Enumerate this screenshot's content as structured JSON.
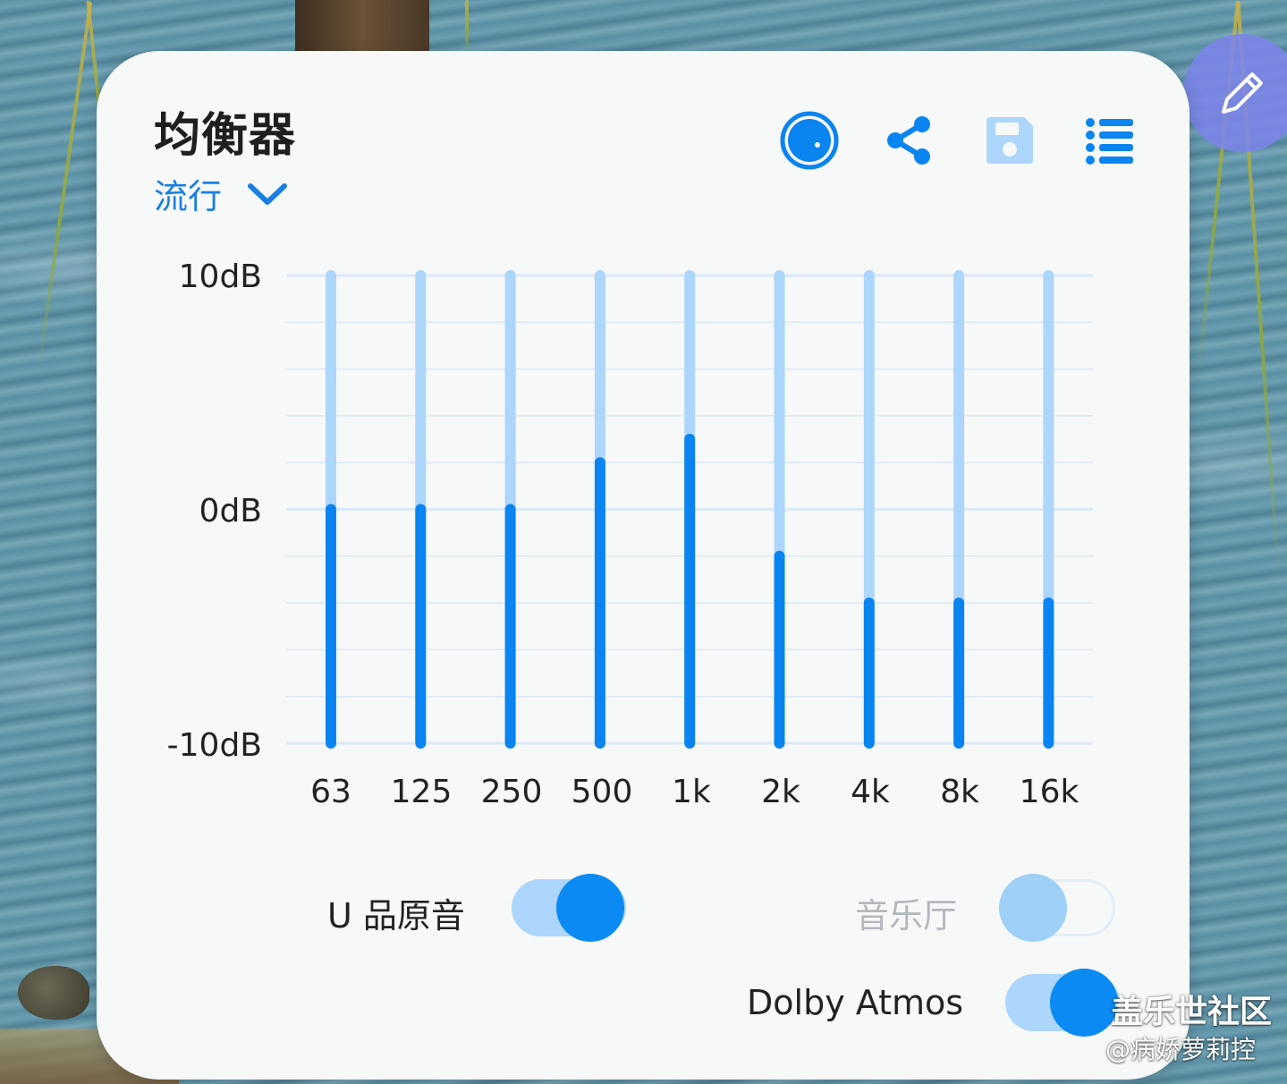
{
  "equalizer": {
    "title": "均衡器",
    "preset": "流行",
    "colors": {
      "accent": "#0a84f0",
      "bar_active": "#0a84f0",
      "bar_track": "#acd6fb",
      "grid": "#dbe9f6",
      "toggle_track_on": "#acd6fb",
      "toggle_knob_on": "#0a8af2",
      "toggle_knob_off": "#9fd0f8",
      "float_button": "#7d84eb"
    },
    "icons": {
      "power": "power-knob-icon",
      "share": "share-icon",
      "save": "save-icon",
      "menu": "list-menu-icon",
      "float": "pencil-icon"
    }
  },
  "chart_data": {
    "type": "bar",
    "categories": [
      "63",
      "125",
      "250",
      "500",
      "1k",
      "2k",
      "4k",
      "8k",
      "16k"
    ],
    "values": [
      0,
      0,
      0,
      2,
      3,
      -2,
      -4,
      -4,
      -4
    ],
    "ylim": [
      -10,
      10
    ],
    "yticks": [
      {
        "value": 10,
        "label": "10dB"
      },
      {
        "value": 0,
        "label": "0dB"
      },
      {
        "value": -10,
        "label": "-10dB"
      }
    ],
    "xlabel": "",
    "ylabel": ""
  },
  "toggles": {
    "u_sound": {
      "label": "U 品原音",
      "on": true
    },
    "concert_hall": {
      "label": "音乐厅",
      "on": false
    },
    "dolby": {
      "label": "Dolby Atmos",
      "on": true
    }
  },
  "watermark": {
    "site": "盖乐世社区",
    "user": "@病娇萝莉控"
  }
}
